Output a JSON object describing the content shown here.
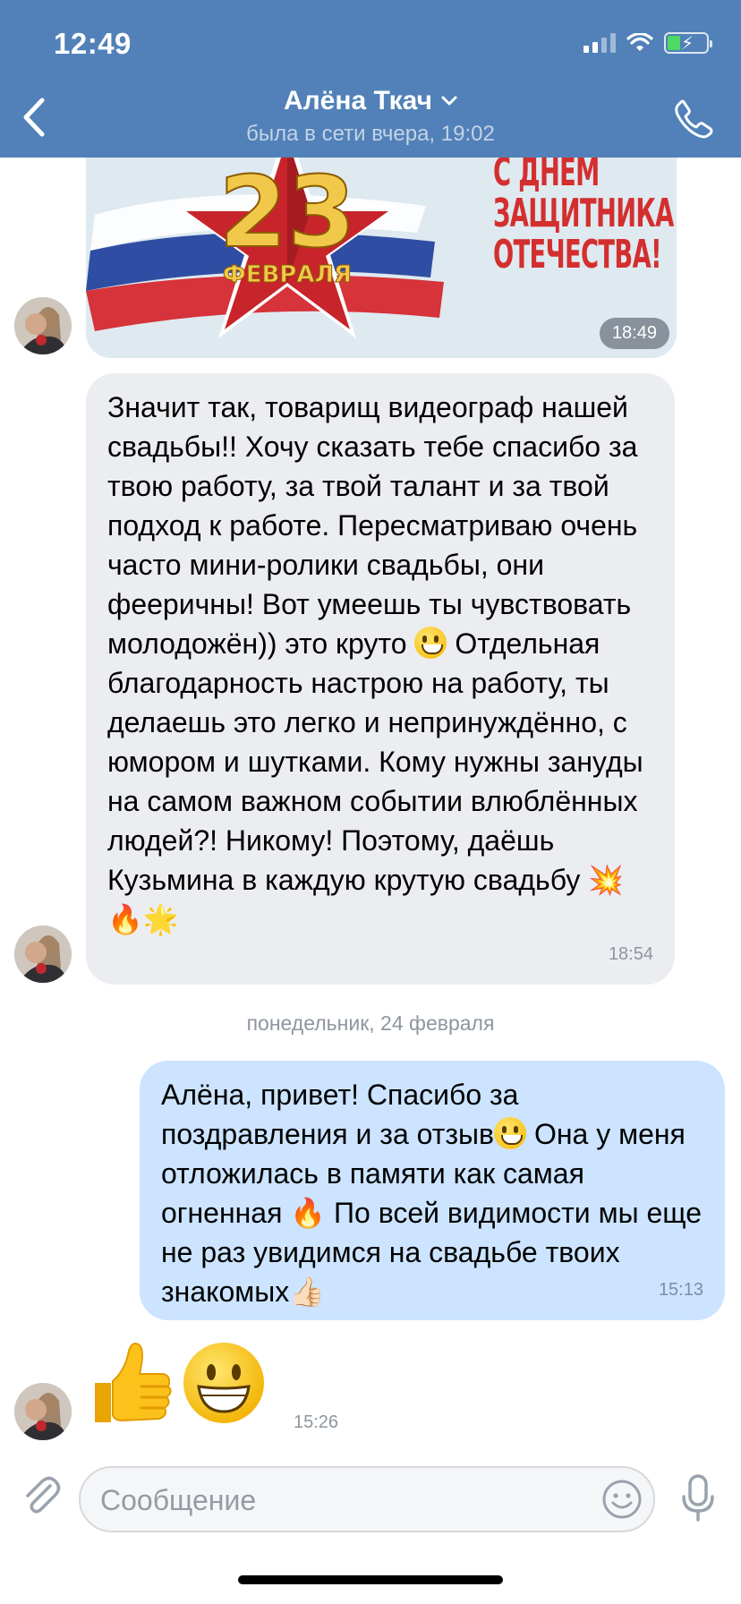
{
  "status_bar": {
    "time": "12:49"
  },
  "header": {
    "contact_name": "Алёна Ткач",
    "last_seen": "была в сети вчера, 19:02"
  },
  "image_message": {
    "caption_lines": [
      "С ДНЕМ",
      "ЗАЩИТНИКА",
      "ОТЕЧЕСТВА!"
    ],
    "number": "23",
    "month": "ФЕВРАЛЯ",
    "time": "18:49"
  },
  "messages": [
    {
      "direction": "in",
      "text_before_emoji": "Значит так, товарищ видеограф нашей свадьбы!! Хочу сказать тебе спасибо за твою работу, за твой талант и за твой подход к работе. Пересматриваю очень часто мини-ролики свадьбы, они фееричны! Вот умеешь ты чувствовать молодожён)) это круто ",
      "text_after_emoji": " Отдельная благодарность настрою на работу, ты делаешь это легко и непринуждённо, с юмором и шутками. Кому нужны зануды на самом важном событии влюблённых людей?! Никому! Поэтому, даёшь Кузьмина в каждую крутую свадьбу ",
      "trailing_emojis": "💥🔥🌟",
      "time": "18:54"
    },
    {
      "direction": "out",
      "text_part1": "Алёна, привет! Спасибо за поздравления и за отзыв",
      "text_part2": " Она у меня отложилась в памяти как самая огненная ",
      "fire_emoji": "🔥",
      "text_part3": " По всей видимости мы еще не раз увидимся на свадьбе твоих знакомых",
      "thumb_emoji": "👍🏻",
      "time": "15:13"
    }
  ],
  "date_separator": "понедельник, 24 февраля",
  "emoji_message": {
    "emojis": [
      "thumbs-up",
      "grinning-face"
    ],
    "time": "15:26"
  },
  "composer": {
    "placeholder": "Сообщение"
  },
  "colors": {
    "header": "#5181b8",
    "incoming_bubble": "#ebedf0",
    "outgoing_bubble": "#cce4ff"
  }
}
